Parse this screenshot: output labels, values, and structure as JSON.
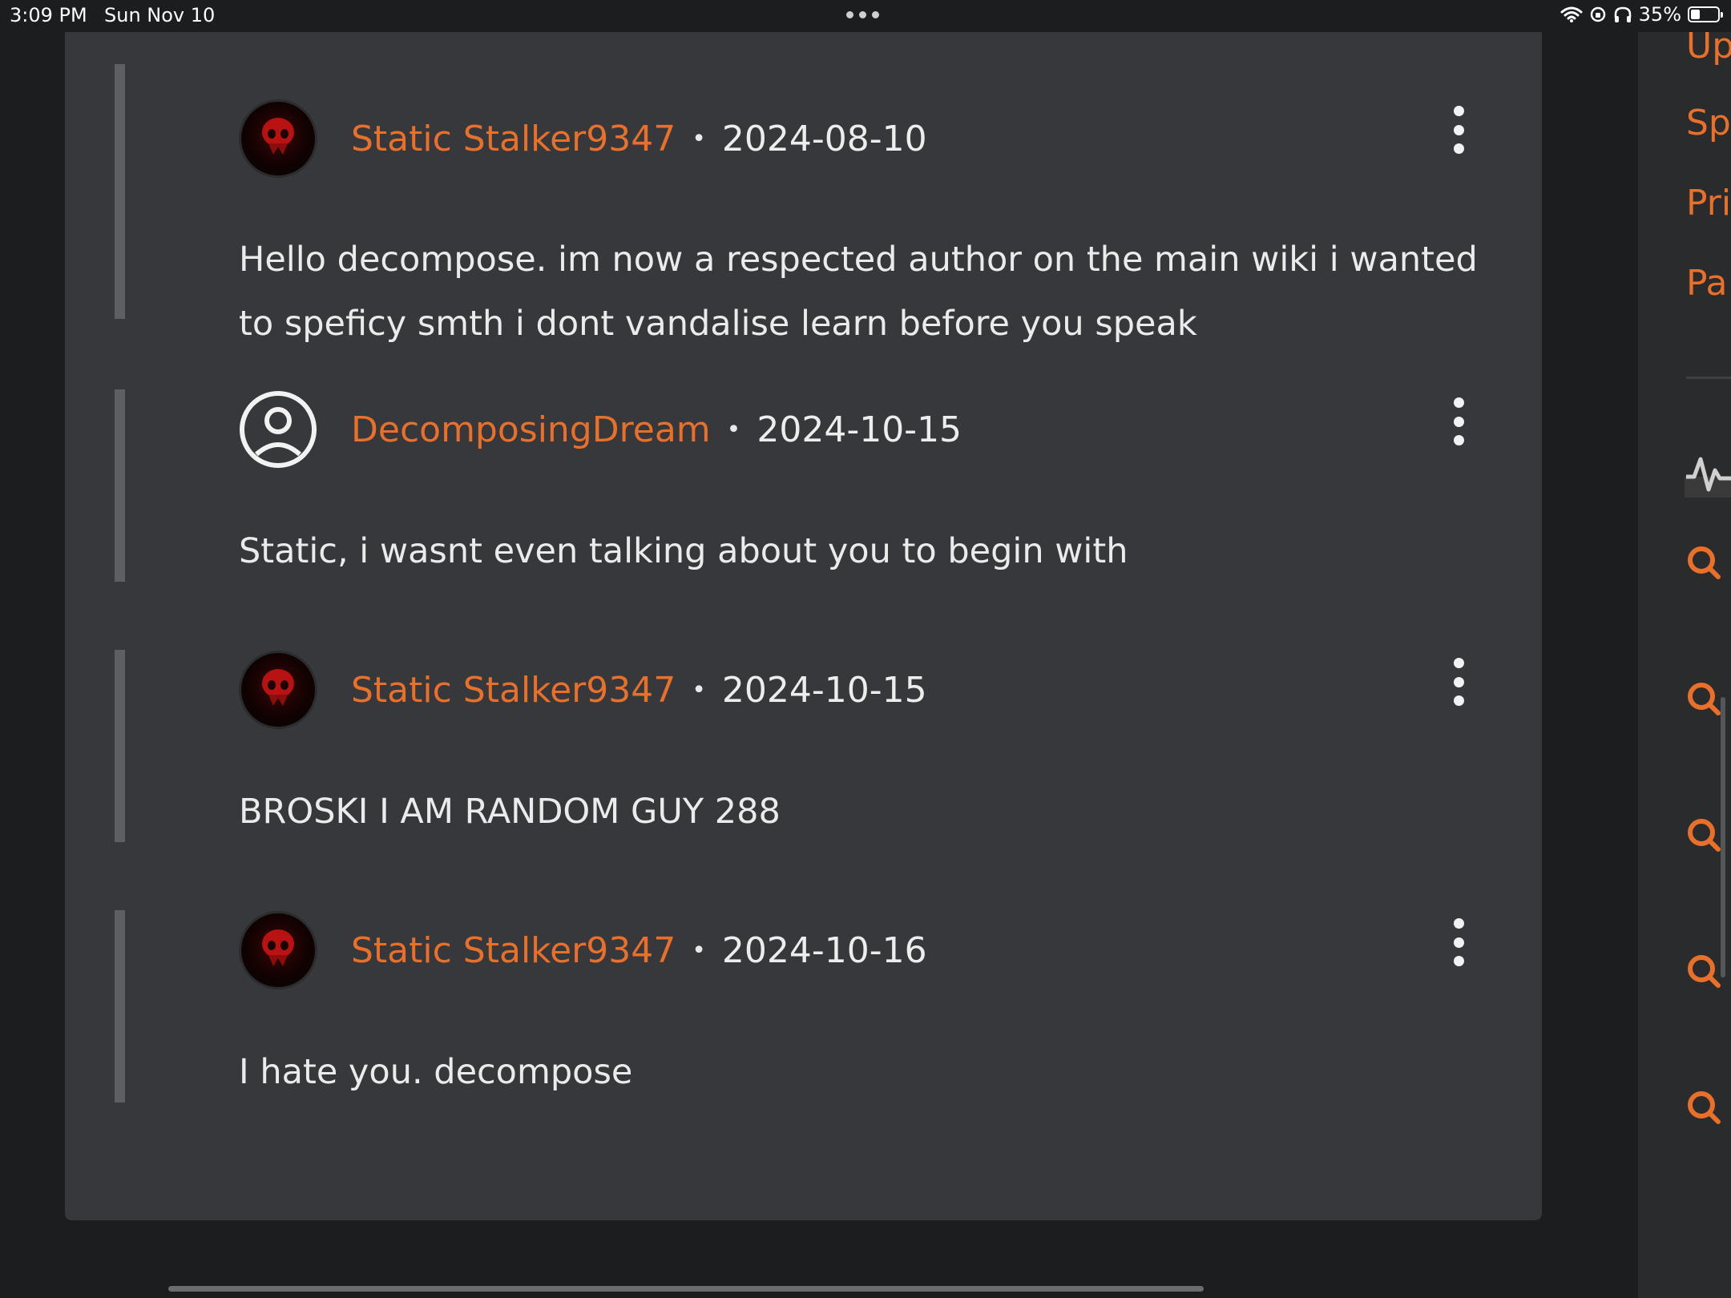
{
  "status_bar": {
    "time": "3:09 PM",
    "date": "Sun Nov 10",
    "battery": "35%",
    "battery_level": 0.35
  },
  "comments": [
    {
      "username": "Static Stalker9347",
      "separator": "•",
      "date": "2024-08-10",
      "body": "Hello decompose. im now a respected author on the main wiki i wanted to speficy smth i dont vandalise learn before you speak",
      "avatar": "red-skull-avatar"
    },
    {
      "username": "DecomposingDream",
      "separator": "•",
      "date": "2024-10-15",
      "body": "Static, i wasnt even talking about you to begin with",
      "avatar": "default-user-avatar"
    },
    {
      "username": "Static Stalker9347",
      "separator": "•",
      "date": "2024-10-15",
      "body": "BROSKI I AM RANDOM GUY 288",
      "avatar": "red-skull-avatar"
    },
    {
      "username": "Static Stalker9347",
      "separator": "•",
      "date": "2024-10-16",
      "body": "I hate you. decompose",
      "avatar": "red-skull-avatar"
    }
  ],
  "sidebar": {
    "links": [
      "Up",
      "Sp",
      "Pri",
      "Pa"
    ],
    "icons": [
      "activity-icon",
      "search-icon",
      "search-icon",
      "search-icon",
      "search-icon",
      "search-icon"
    ]
  },
  "colors": {
    "accent": "#e8702a",
    "panel": "#37383b",
    "background": "#1c1d1f",
    "text": "#ebebeb"
  }
}
